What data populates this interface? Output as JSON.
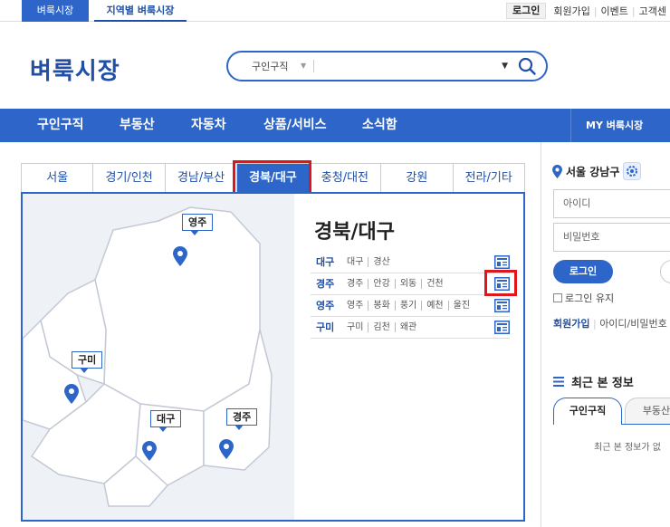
{
  "top": {
    "site_tabs": [
      "벼룩시장",
      "지역별 벼룩시장"
    ],
    "util": [
      "로그인",
      "회원가입",
      "이벤트",
      "고객센"
    ]
  },
  "header": {
    "logo": "벼룩시장",
    "search_category": "구인구직",
    "search_value": ""
  },
  "nav": {
    "items": [
      "구인구직",
      "부동산",
      "자동차",
      "상품/서비스",
      "소식함"
    ],
    "my": "MY 벼룩시장"
  },
  "regions": {
    "tabs": [
      "서울",
      "경기/인천",
      "경남/부산",
      "경북/대구",
      "충청/대전",
      "강원",
      "전라/기타"
    ],
    "active_index": 3
  },
  "panel": {
    "title": "경북/대구",
    "rows": [
      {
        "city": "대구",
        "towns": [
          "대구",
          "경산"
        ]
      },
      {
        "city": "경주",
        "towns": [
          "경주",
          "안강",
          "외동",
          "건천"
        ]
      },
      {
        "city": "영주",
        "towns": [
          "영주",
          "봉화",
          "풍기",
          "예천",
          "울진"
        ]
      },
      {
        "city": "구미",
        "towns": [
          "구미",
          "김천",
          "왜관"
        ]
      }
    ],
    "map_labels": [
      "영주",
      "구미",
      "대구",
      "경주"
    ]
  },
  "side": {
    "location": "서울 강남구",
    "id_placeholder": "아이디",
    "pw_placeholder": "비밀번호",
    "login": "로그인",
    "keep_login": "로그인 유지",
    "join": "회원가입",
    "find": "아이디/비밀번호",
    "recent_title": "최근 본 정보",
    "recent_tabs": [
      "구인구직",
      "부동산"
    ],
    "recent_empty": "최근 본 정보가 없"
  },
  "colors": {
    "brand": "#2d66c8",
    "highlight": "#e0161b"
  }
}
